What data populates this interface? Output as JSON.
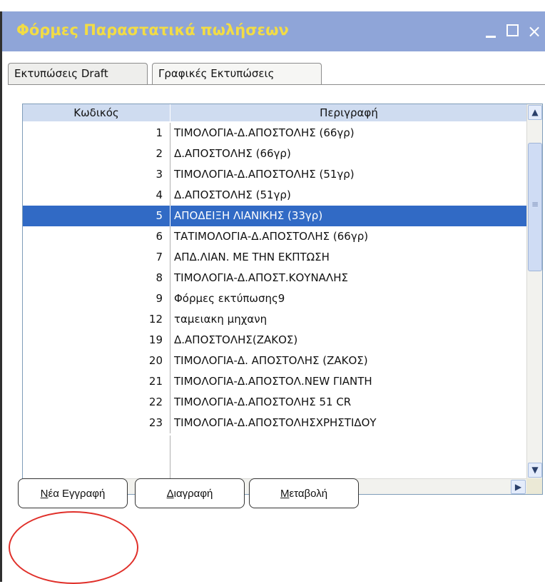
{
  "window": {
    "title": "Φόρμες Παραστατικά πωλήσεων",
    "close_glyph": "×"
  },
  "tabs": [
    {
      "label": "Εκτυπώσεις Draft",
      "active": true
    },
    {
      "label": "Γραφικές Εκτυπώσεις",
      "active": false
    }
  ],
  "grid": {
    "columns": [
      "Κωδικός",
      "Περιγραφή"
    ],
    "rows": [
      {
        "code": "1",
        "desc": "ΤΙΜΟΛΟΓΙΑ-Δ.ΑΠΟΣΤΟΛΗΣ (66γρ)"
      },
      {
        "code": "2",
        "desc": "Δ.ΑΠΟΣΤΟΛΗΣ (66γρ)"
      },
      {
        "code": "3",
        "desc": "ΤΙΜΟΛΟΓΙΑ-Δ.ΑΠΟΣΤΟΛΗΣ (51γρ)"
      },
      {
        "code": "4",
        "desc": "Δ.ΑΠΟΣΤΟΛΗΣ (51γρ)"
      },
      {
        "code": "5",
        "desc": "ΑΠΟΔΕΙΞΗ ΛΙΑΝΙΚΗΣ (33γρ)",
        "selected": true
      },
      {
        "code": "6",
        "desc": "ΤΑΤΙΜΟΛΟΓΙΑ-Δ.ΑΠΟΣΤΟΛΗΣ (66γρ)"
      },
      {
        "code": "7",
        "desc": "ΑΠΔ.ΛΙΑΝ. ΜΕ ΤΗΝ ΕΚΠΤΩΣΗ"
      },
      {
        "code": "8",
        "desc": "ΤΙΜΟΛΟΓΙΑ-Δ.ΑΠΟΣΤ.ΚΟΥΝΑΛΗΣ"
      },
      {
        "code": "9",
        "desc": "Φόρμες εκτύπωσης9"
      },
      {
        "code": "12",
        "desc": "ταμειακη μηχανη"
      },
      {
        "code": "19",
        "desc": "Δ.ΑΠΟΣΤΟΛΗΣ(ΖΑΚΟΣ)"
      },
      {
        "code": "20",
        "desc": "ΤΙΜΟΛΟΓΙΑ-Δ. ΑΠΟΣΤΟΛΗΣ (ΖΑΚΟΣ)"
      },
      {
        "code": "21",
        "desc": "ΤΙΜΟΛΟΓΙΑ-Δ.ΑΠΟΣΤΟΛ.NEW ΓΙΑΝΤΗ"
      },
      {
        "code": "22",
        "desc": "ΤΙΜΟΛΟΓΙΑ-Δ.ΑΠΟΣΤΟΛΗΣ 51 CR"
      },
      {
        "code": "23",
        "desc": "ΤΙΜΟΛΟΓΙΑ-Δ.ΑΠΟΣΤΟΛΗΣΧΡΗΣΤΙΔΟΥ"
      }
    ]
  },
  "scroll": {
    "up": "▲",
    "down": "▼",
    "left": "◀",
    "right": "▶"
  },
  "buttons": {
    "new_mnemonic": "Ν",
    "new_rest": "έα Εγγραφή",
    "delete_mnemonic": "Δ",
    "delete_rest": "ιαγραφή",
    "change_mnemonic": "Μ",
    "change_rest": "εταβολή"
  },
  "colors": {
    "titlebar": "#8fa5d8",
    "title_text": "#f2dc45",
    "selection": "#316ac5",
    "highlight_circle": "#e0302a"
  }
}
